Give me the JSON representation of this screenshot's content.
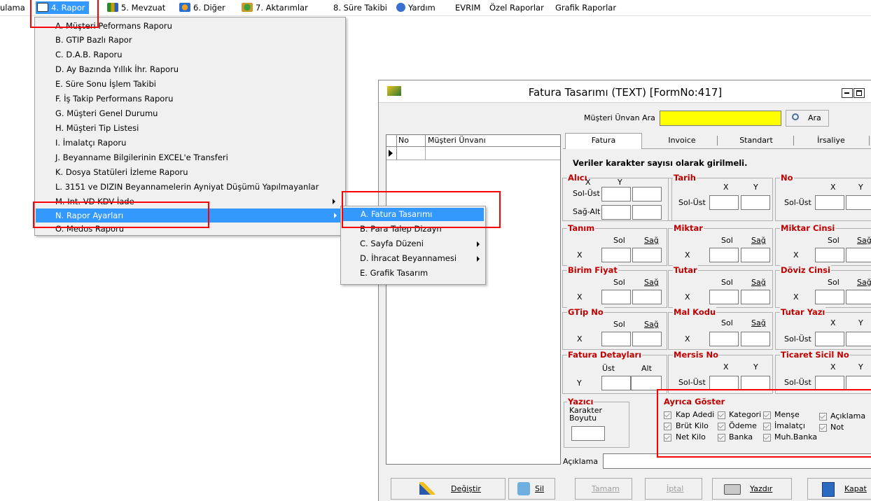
{
  "menubar": {
    "items": [
      {
        "label": "ulama"
      },
      {
        "label": "4. Rapor"
      },
      {
        "label": "5. Mevzuat"
      },
      {
        "label": "6. Diğer"
      },
      {
        "label": "7. Aktarımlar"
      },
      {
        "label": "8. Süre Takibi"
      },
      {
        "label": "Yardım"
      },
      {
        "label": "EVRIM"
      },
      {
        "label": "Özel Raporlar"
      },
      {
        "label": "Grafik Raporlar"
      }
    ]
  },
  "dropdown": {
    "items": [
      {
        "label": "A.  Müşteri Peformans Raporu"
      },
      {
        "label": "B.  GTIP Bazlı Rapor"
      },
      {
        "label": "C.  D.A.B. Raporu"
      },
      {
        "label": "D.  Ay Bazında Yıllık İhr. Raporu"
      },
      {
        "label": "E.  Süre Sonu İşlem Takibi"
      },
      {
        "label": "F.  İş Takip Performans Raporu"
      },
      {
        "label": "G.  Müşteri Genel Durumu"
      },
      {
        "label": "H.  Müşteri Tip Listesi"
      },
      {
        "label": "I.  İmalatçı Raporu"
      },
      {
        "label": "J.  Beyanname Bilgilerinin EXCEL'e Transferi"
      },
      {
        "label": "K.  Dosya Statüleri İzleme Raporu"
      },
      {
        "label": "L.  3151 ve DIZIN Beyannamelerin Ayniyat Düşümü Yapılmayanlar"
      },
      {
        "label": "M.  Int. VD KDV İade"
      },
      {
        "label": "N.  Rapor Ayarları"
      },
      {
        "label": "O.  Medos Raporu"
      }
    ]
  },
  "submenu": {
    "items": [
      {
        "label": "A.  Fatura Tasarımı"
      },
      {
        "label": "B.  Para Talep Dizayn"
      },
      {
        "label": "C.  Sayfa Düzeni"
      },
      {
        "label": "D.  İhracat Beyannamesi"
      },
      {
        "label": "E.  Grafik Tasarım"
      }
    ]
  },
  "form": {
    "title": "Fatura Tasarımı (TEXT) [FormNo:417]",
    "search_label": "Müşteri Ünvan Ara",
    "search_value": "",
    "search_button": "Ara",
    "grid_headers": [
      "No",
      "Müşteri Ünvanı"
    ],
    "tabs": [
      "Fatura",
      "Invoice",
      "Standart",
      "İrsaliye"
    ],
    "note": "Veriler karakter sayısı olarak girilmeli.",
    "groups": {
      "alici": "Alıcı",
      "tarih": "Tarih",
      "no": "No",
      "tanim": "Tanım",
      "miktar": "Miktar",
      "miktar_cinsi": "Miktar Cinsi",
      "birim_fiyat": "Birim Fiyat",
      "tutar": "Tutar",
      "doviz_cinsi": "Döviz Cinsi",
      "gtip_no": "GTip No",
      "mal_kodu": "Mal Kodu",
      "tutar_yazi": "Tutar Yazı",
      "fatura_detaylari": "Fatura Detayları",
      "mersis_no": "Mersis No",
      "ticaret_sicil_no": "Ticaret Sicil No",
      "yazici": "Yazıcı",
      "ayrica_goster": "Ayrıca Göster"
    },
    "labels": {
      "x": "X",
      "y": "Y",
      "sol": "Sol",
      "sag": "Sağ",
      "ust": "Üst",
      "alt": "Alt",
      "sol_ust": "Sol-Üst",
      "sag_alt": "Sağ-Alt",
      "karakter_boyutu": "Karakter\nBoyutu",
      "aciklama": "Açıklama"
    },
    "checkboxes": [
      {
        "label": "Kap Adedi",
        "checked": true
      },
      {
        "label": "Kategori",
        "checked": true
      },
      {
        "label": "Menşe",
        "checked": true
      },
      {
        "label": "Açıklama",
        "checked": true
      },
      {
        "label": "Brüt Kilo",
        "checked": true
      },
      {
        "label": "Ödeme",
        "checked": true
      },
      {
        "label": "İmalatçı",
        "checked": true
      },
      {
        "label": "Not",
        "checked": true
      },
      {
        "label": "Net Kilo",
        "checked": true
      },
      {
        "label": "Banka",
        "checked": true
      },
      {
        "label": "Muh.Banka",
        "checked": true
      }
    ],
    "buttons": [
      "Değiştir",
      "Sil",
      "Tamam",
      "İptal",
      "Yazdır",
      "Kapat"
    ]
  },
  "colors": {
    "accent": "#3399ff",
    "highlight": "#ff0000",
    "search_bg": "#ffff00",
    "group_title": "#c00000"
  }
}
